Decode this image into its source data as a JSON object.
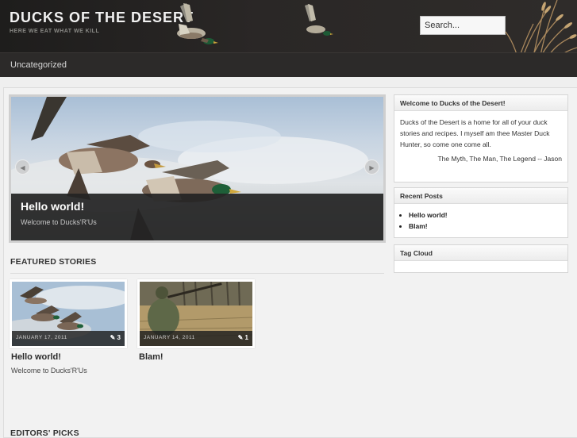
{
  "site": {
    "title": "DUCKS OF THE DESERT",
    "tagline": "HERE WE EAT WHAT WE KILL"
  },
  "search": {
    "value": "Search..."
  },
  "nav": {
    "items": [
      "Uncategorized"
    ]
  },
  "slider": {
    "title": "Hello world!",
    "excerpt": "Welcome to Ducks'R'Us"
  },
  "featured": {
    "heading": "FEATURED STORIES",
    "posts": [
      {
        "date": "JANUARY 17, 2011",
        "comments": "3",
        "title": "Hello world!",
        "excerpt": "Welcome to Ducks'R'Us"
      },
      {
        "date": "JANUARY 14, 2011",
        "comments": "1",
        "title": "Blam!",
        "excerpt": ""
      }
    ]
  },
  "editors": {
    "heading": "EDITORS' PICKS"
  },
  "sidebar": {
    "welcome": {
      "title": "Welcome to Ducks of the Desert!",
      "text": "Ducks of the Desert is a home for all of your duck stories and recipes. I myself am thee Master Duck Hunter, so come one come all.",
      "signature": "The Myth, The Man, The Legend -- Jason"
    },
    "recent": {
      "title": "Recent Posts",
      "items": [
        "Hello world!",
        "Blam!"
      ]
    },
    "tagcloud": {
      "title": "Tag Cloud"
    }
  },
  "icons": {
    "prev": "arrow-left-icon",
    "next": "arrow-right-icon",
    "comment": "comment-bubble-icon"
  },
  "colors": {
    "header_bg": "#232120",
    "nav_bg": "#2c2a29",
    "page_bg": "#f2f2f2",
    "caption_bg": "#232323"
  }
}
